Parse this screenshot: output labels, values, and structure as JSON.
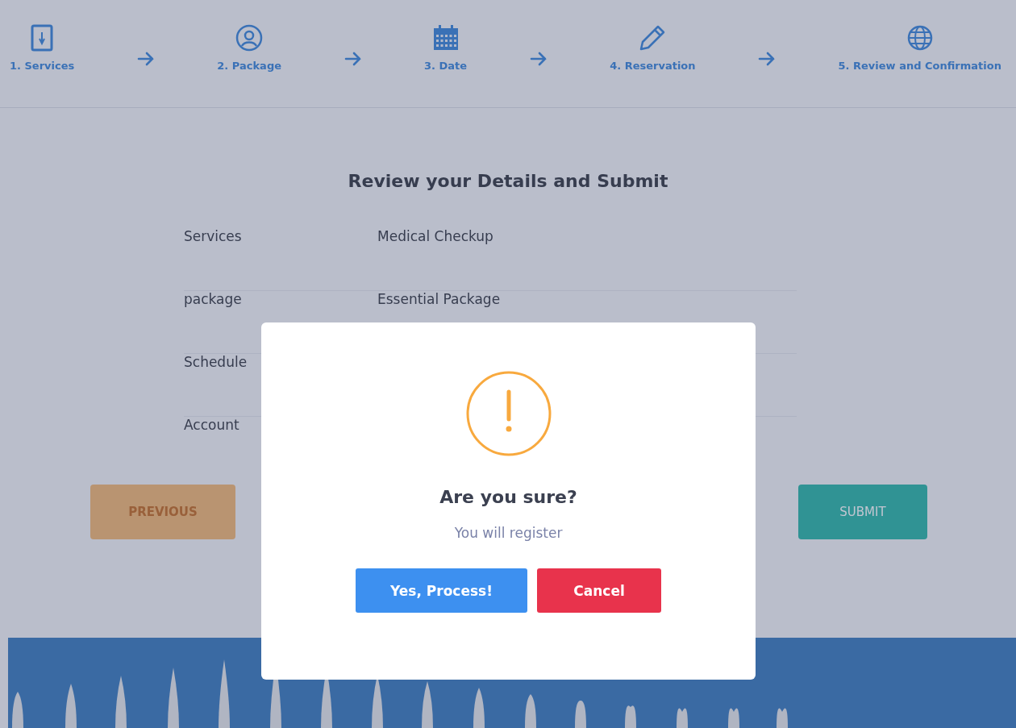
{
  "steps": [
    {
      "label": "1. Services",
      "kind": "document"
    },
    {
      "label": "2. Package",
      "kind": "user"
    },
    {
      "label": "3. Date",
      "kind": "calendar"
    },
    {
      "label": "4. Reservation",
      "kind": "pencil"
    },
    {
      "label": "5. Review and Confirmation",
      "kind": "globe"
    }
  ],
  "heading": "Review your Details and Submit",
  "details": [
    {
      "label": "Services",
      "value": "Medical Checkup"
    },
    {
      "label": "package",
      "value": "Essential Package"
    },
    {
      "label": "Schedule"
    },
    {
      "label": "Account"
    }
  ],
  "buttons": {
    "previous": "PREVIOUS",
    "submit": "SUBMIT"
  },
  "dialog": {
    "title": "Are you sure?",
    "message": "You will register",
    "confirm": "Yes, Process!",
    "cancel": "Cancel"
  }
}
